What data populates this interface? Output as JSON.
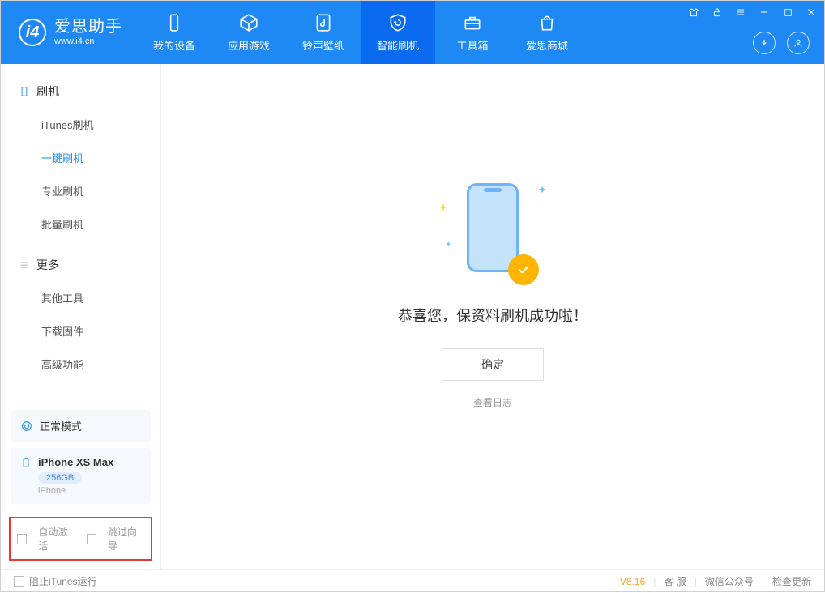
{
  "app": {
    "title": "爱思助手",
    "subtitle": "www.i4.cn"
  },
  "tabs": {
    "device": "我的设备",
    "apps": "应用游戏",
    "ringtones": "铃声壁纸",
    "flash": "智能刷机",
    "toolbox": "工具箱",
    "store": "爱思商城"
  },
  "sidebar": {
    "group1_title": "刷机",
    "items1": [
      "iTunes刷机",
      "一键刷机",
      "专业刷机",
      "批量刷机"
    ],
    "group2_title": "更多",
    "items2": [
      "其他工具",
      "下载固件",
      "高级功能"
    ]
  },
  "mode_box": {
    "label": "正常模式"
  },
  "device_box": {
    "name": "iPhone XS Max",
    "capacity": "256GB",
    "type": "iPhone"
  },
  "options": {
    "auto_activate": "自动激活",
    "skip_guide": "跳过向导"
  },
  "main": {
    "success_msg": "恭喜您，保资料刷机成功啦！",
    "ok_btn": "确定",
    "log_link": "查看日志"
  },
  "footer": {
    "block_itunes": "阻止iTunes运行",
    "version": "V8.16",
    "support": "客 服",
    "wechat": "微信公众号",
    "update": "检查更新"
  }
}
